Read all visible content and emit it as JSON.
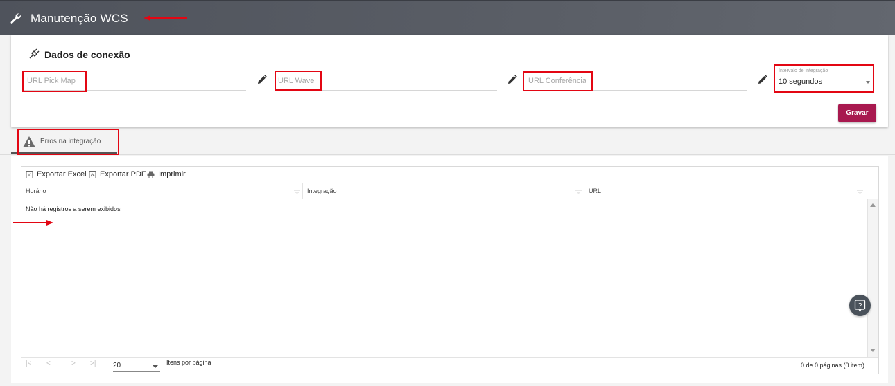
{
  "header": {
    "title": "Manutenção WCS",
    "icon": "wrench-icon"
  },
  "connection": {
    "title": "Dados de conexão",
    "icon": "plug-icon",
    "fields": {
      "pick_map": {
        "placeholder": "URL Pick Map"
      },
      "wave": {
        "placeholder": "URL Wave"
      },
      "conferencia": {
        "placeholder": "URL Conferência"
      }
    },
    "interval": {
      "label": "Intervalo de integração",
      "value": "10 segundos"
    },
    "save_label": "Gravar"
  },
  "tabs": [
    {
      "label": "Erros na integração",
      "icon": "warning-icon",
      "active": true
    }
  ],
  "grid": {
    "toolbar": {
      "excel": "Exportar Excel",
      "pdf": "Exportar PDF",
      "print": "Imprimir"
    },
    "columns": [
      "Horário",
      "Integração",
      "URL"
    ],
    "empty_message": "Não há registros a serem exibidos",
    "pager": {
      "first": "|<",
      "prev": "<",
      "next": ">",
      "last": ">|",
      "page_size": "20",
      "page_size_label": "Itens por página",
      "info": "0 de 0 páginas (0 item)"
    }
  },
  "colors": {
    "header": "#575b63",
    "save_button": "#a8194f",
    "annotation": "#e30613",
    "help_button": "#4a525b"
  }
}
